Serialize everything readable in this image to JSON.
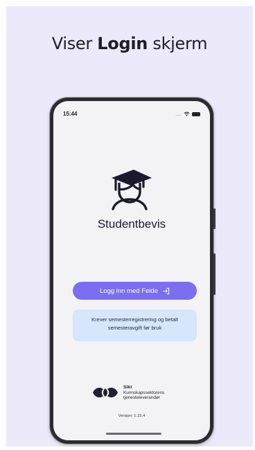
{
  "headline": {
    "prefix": "Viser ",
    "bold": "Login",
    "suffix": " skjerm"
  },
  "statusbar": {
    "time": "15:44",
    "signal_dots": "....",
    "wifi_icon": "wifi-icon",
    "battery_icon": "battery-icon"
  },
  "app": {
    "name": "Studentbevis",
    "logo_icon": "graduate-cap-icon",
    "login_button_label": "Logg inn med Feide",
    "login_icon": "login-arrow-icon",
    "notice_line1": "Krever semesterregistrering og betalt",
    "notice_line2": "semesteravgift før bruk",
    "version": "Versjon: 1.15.4"
  },
  "footer": {
    "brand": "Sikt",
    "line1": "Kunnskapssektorens",
    "line2": "tjenesteleverandør",
    "logo_icon": "sikt-logo-icon"
  },
  "colors": {
    "background": "#ece9fb",
    "primary_button": "#7b6ef0",
    "notice_bg": "#d6e6fb",
    "ink": "#1a1a2e"
  }
}
